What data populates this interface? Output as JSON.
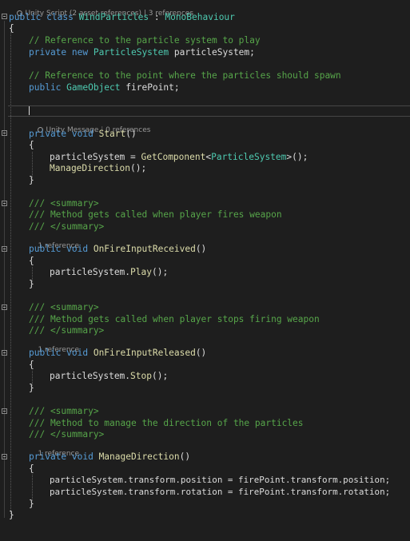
{
  "codelens": {
    "class_refs": "Unity Script (2 asset references) | 3 references",
    "start_msg": "Unity Message",
    "start_refs": "0 references",
    "ref1": "1 reference"
  },
  "code": {
    "class_kw": "public class ",
    "class_name": "WindParticles",
    "class_colon": " : ",
    "class_base": "MonoBehaviour",
    "brace_open": "{",
    "brace_close": "}",
    "c1": "// Reference to the particle system to play",
    "f1_kw": "private new ",
    "f1_type": "ParticleSystem",
    "f1_name": " particleSystem;",
    "c2": "// Reference to the point where the particles should spawn",
    "f2_kw": "public ",
    "f2_type": "GameObject",
    "f2_name": " firePoint;",
    "m1_kw": "private void ",
    "m1_name": "Start",
    "m1_paren": "()",
    "s1a": "particleSystem = ",
    "s1b": "GetComponent",
    "s1c": "<",
    "s1d": "ParticleSystem",
    "s1e": ">();",
    "s2a": "ManageDirection",
    "s2b": "();",
    "doc_open": "/// <summary>",
    "doc_close": "/// </summary>",
    "d1": "/// Method gets called when player fires weapon",
    "m2_kw": "public void ",
    "m2_name": "OnFireInputReceived",
    "m2_paren": "()",
    "s3a": "particleSystem.",
    "s3b": "Play",
    "s3c": "();",
    "d2": "/// Method gets called when player stops firing weapon",
    "m3_kw": "public void ",
    "m3_name": "OnFireInputReleased",
    "m3_paren": "()",
    "s4a": "particleSystem.",
    "s4b": "Stop",
    "s4c": "();",
    "d3": "/// Method to manage the direction of the particles",
    "m4_kw": "private void ",
    "m4_name": "ManageDirection",
    "m4_paren": "()",
    "s5": "particleSystem.transform.position = firePoint.transform.position;",
    "s6": "particleSystem.transform.rotation = firePoint.transform.rotation;"
  }
}
